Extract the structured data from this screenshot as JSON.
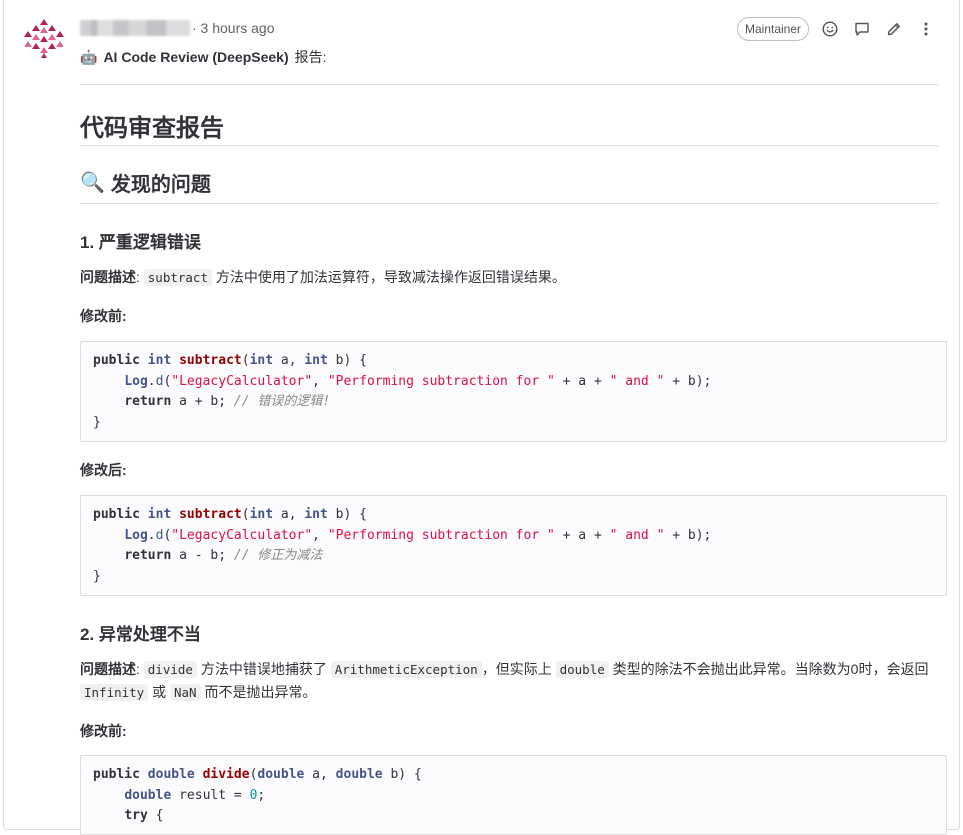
{
  "note": {
    "time": "· 3 hours ago",
    "role_badge": "Maintainer",
    "bot_emoji": "🤖",
    "bot_title": "AI Code Review (DeepSeek)",
    "bot_suffix": "报告:"
  },
  "report": {
    "title": "代码审查报告",
    "section_icon": "🔍",
    "section_title": "发现的问题",
    "issue1": {
      "title": "1. 严重逻辑错误",
      "desc_label": "问题描述",
      "desc_code": "subtract",
      "desc_text": " 方法中使用了加法运算符，导致减法操作返回错误结果。",
      "before_label": "修改前:",
      "after_label": "修改后:"
    },
    "issue2": {
      "title": "2. 异常处理不当",
      "desc_label": "问题描述",
      "desc_code1": "divide",
      "desc_text1": " 方法中错误地捕获了 ",
      "desc_code2": "ArithmeticException",
      "desc_text2": "，但实际上 ",
      "desc_code3": "double",
      "desc_text3": " 类型的除法不会抛出此异常。当除数为0时，会返回",
      "desc_code4": "Infinity",
      "desc_text4": " 或 ",
      "desc_code5": "NaN",
      "desc_text5": " 而不是抛出异常。",
      "before_label": "修改前:"
    }
  }
}
